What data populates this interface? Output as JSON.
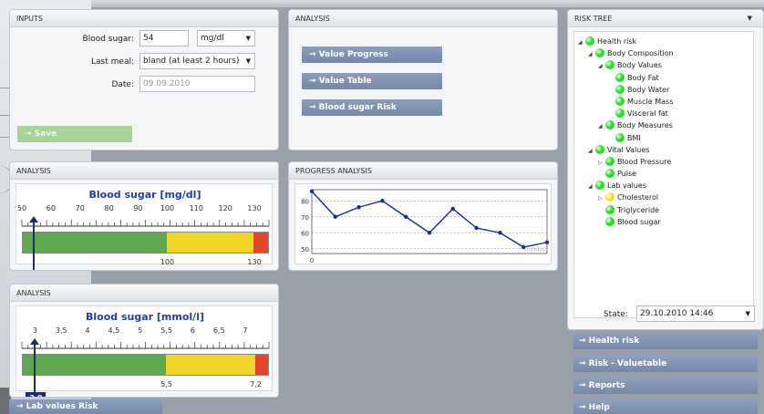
{
  "inputs": {
    "header": "INPUTS",
    "blood_sugar_label": "Blood sugar:",
    "blood_sugar_value": "54",
    "unit_value": "mg/dl",
    "last_meal_label": "Last meal:",
    "last_meal_value": "bland (at least 2 hours)",
    "date_label": "Date:",
    "date_value": "09.09.2010",
    "save_label": "→ Save"
  },
  "analysis_top": {
    "header": "ANALYSIS",
    "buttons": [
      "→ Value Progress",
      "→ Value Table",
      "→ Blood sugar Risk"
    ]
  },
  "gauge_mg": {
    "header": "ANALYSIS",
    "title": "Blood sugar [mg/dl]",
    "ticks": [
      "50",
      "60",
      "70",
      "80",
      "90",
      "100",
      "110",
      "120",
      "130"
    ],
    "band_labels": [
      "100",
      "130"
    ],
    "value": "54",
    "scale_min": 50,
    "scale_max": 135,
    "marker_value": 54,
    "bands": [
      {
        "from": 50,
        "to": 100,
        "color": "#5fa84f"
      },
      {
        "from": 100,
        "to": 130,
        "color": "#f0d427"
      },
      {
        "from": 130,
        "to": 135,
        "color": "#e2472a"
      }
    ]
  },
  "gauge_mmol": {
    "header": "ANALYSIS",
    "title": "Blood sugar [mmol/l]",
    "ticks": [
      "3",
      "3,5",
      "4",
      "4,5",
      "5",
      "5,5",
      "6",
      "6,5",
      "7"
    ],
    "band_labels": [
      "5,5",
      "7,2"
    ],
    "value": "3,0",
    "scale_min": 2.75,
    "scale_max": 7.45,
    "marker_value": 3.0,
    "bands": [
      {
        "from": 2.75,
        "to": 5.5,
        "color": "#5fa84f"
      },
      {
        "from": 5.5,
        "to": 7.2,
        "color": "#f0d427"
      },
      {
        "from": 7.2,
        "to": 7.45,
        "color": "#e2472a"
      }
    ]
  },
  "progress": {
    "header": "PROGRESS ANALYSIS",
    "y_ticks": [
      "80",
      "70",
      "60",
      "50"
    ],
    "x_tick": "0",
    "watermark": "Dundas"
  },
  "chart_data": {
    "type": "line",
    "title": "",
    "xlabel": "",
    "ylabel": "",
    "ylim": [
      47,
      87
    ],
    "x": [
      0,
      1,
      2,
      3,
      4,
      5,
      6,
      7,
      8,
      9,
      10
    ],
    "series": [
      {
        "values": [
          86,
          70,
          76,
          80,
          70,
          60,
          75,
          63,
          60,
          51,
          54
        ]
      }
    ]
  },
  "risk_tree": {
    "header": "RISK TREE",
    "nodes": [
      {
        "label": "Health risk",
        "level": 0,
        "color": "#22dd22",
        "expander": "◢"
      },
      {
        "label": "Body Composition",
        "level": 1,
        "color": "#22dd22",
        "expander": "◢"
      },
      {
        "label": "Body Values",
        "level": 2,
        "color": "#22dd22",
        "expander": "◢"
      },
      {
        "label": "Body Fat",
        "level": 3,
        "color": "#22dd22",
        "expander": ""
      },
      {
        "label": "Body Water",
        "level": 3,
        "color": "#22dd22",
        "expander": ""
      },
      {
        "label": "Muscle Mass",
        "level": 3,
        "color": "#22dd22",
        "expander": ""
      },
      {
        "label": "Visceral fat",
        "level": 3,
        "color": "#22dd22",
        "expander": ""
      },
      {
        "label": "Body Measures",
        "level": 2,
        "color": "#22dd22",
        "expander": "◢"
      },
      {
        "label": "BMI",
        "level": 3,
        "color": "#22dd22",
        "expander": ""
      },
      {
        "label": "Vital Values",
        "level": 1,
        "color": "#22dd22",
        "expander": "◢"
      },
      {
        "label": "Blood Pressure",
        "level": 2,
        "color": "#22dd22",
        "expander": "▷"
      },
      {
        "label": "Pulse",
        "level": 2,
        "color": "#22dd22",
        "expander": ""
      },
      {
        "label": "Lab values",
        "level": 1,
        "color": "#22dd22",
        "expander": "◢"
      },
      {
        "label": "Cholesterol",
        "level": 2,
        "color": "#f4e21a",
        "expander": "▷"
      },
      {
        "label": "Triglyceride",
        "level": 2,
        "color": "#22dd22",
        "expander": ""
      },
      {
        "label": "Blood sugar",
        "level": 2,
        "color": "#22dd22",
        "expander": ""
      }
    ],
    "state_label": "State:",
    "state_value": "29.10.2010 14:46"
  },
  "right_buttons": [
    "→ Health risk",
    "→ Risk - Valuetable",
    "→ Reports",
    "→ Help"
  ],
  "lab_values_risk": "→ Lab values Risk"
}
